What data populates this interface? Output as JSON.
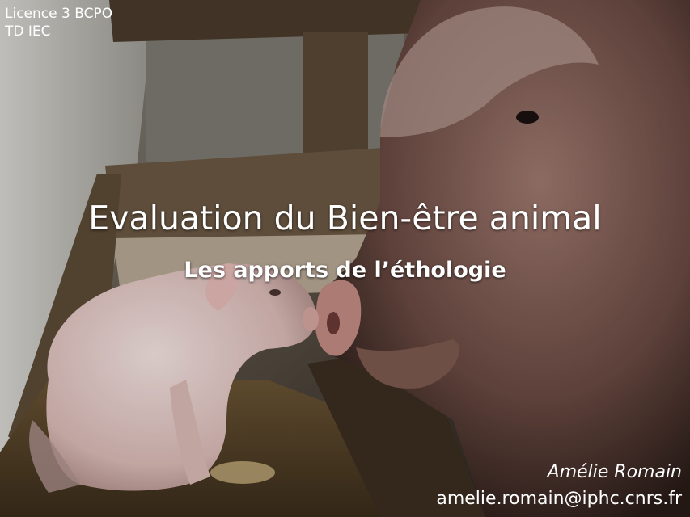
{
  "course": {
    "line1": "Licence 3 BCPO",
    "line2": "TD IEC"
  },
  "title": "Evaluation du Bien-être animal",
  "subtitle": "Les apports de l’éthologie",
  "author": {
    "name": "Amélie Romain",
    "email": "amelie.romain@iphc.cnrs.fr"
  },
  "background": {
    "icon": "pig-and-piglet-photo",
    "accent": "#ffffff"
  }
}
